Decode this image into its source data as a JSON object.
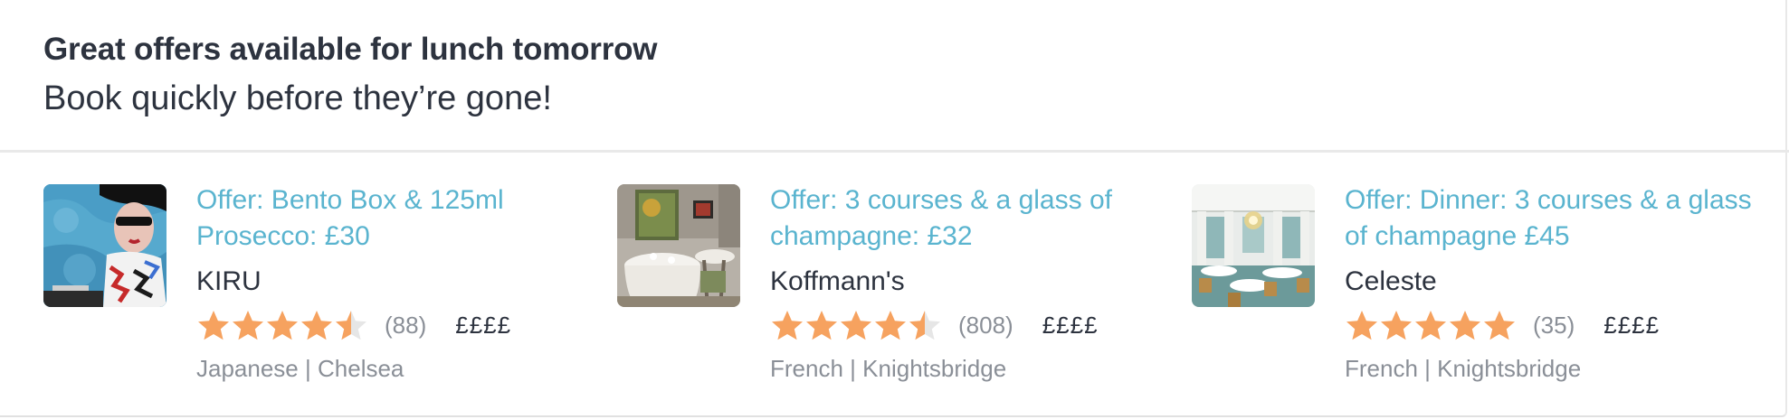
{
  "header": {
    "title": "Great offers available for lunch tomorrow",
    "subtitle": "Book quickly before they’re gone!"
  },
  "colors": {
    "accent": "#5ab4cf",
    "star": "#f6a25f",
    "star_empty": "#e6e6e6",
    "muted": "#8a8f97",
    "text": "#2d333f"
  },
  "offers": [
    {
      "offer": "Offer: Bento Box & 125ml Prosecco: £30",
      "name": "KIRU",
      "rating": 4.5,
      "reviews": "(88)",
      "price": "££££",
      "cuisine": "Japanese",
      "separator": "|",
      "area": "Chelsea",
      "image_icon": "restaurant-photo"
    },
    {
      "offer": "Offer: 3 courses & a glass of champagne: £32",
      "name": "Koffmann's",
      "rating": 4.5,
      "reviews": "(808)",
      "price": "££££",
      "cuisine": "French",
      "separator": "|",
      "area": "Knightsbridge",
      "image_icon": "restaurant-photo"
    },
    {
      "offer": "Offer: Dinner: 3 courses & a glass of champagne £45",
      "name": "Celeste",
      "rating": 5,
      "reviews": "(35)",
      "price": "££££",
      "cuisine": "French",
      "separator": "|",
      "area": "Knightsbridge",
      "image_icon": "restaurant-photo"
    }
  ]
}
